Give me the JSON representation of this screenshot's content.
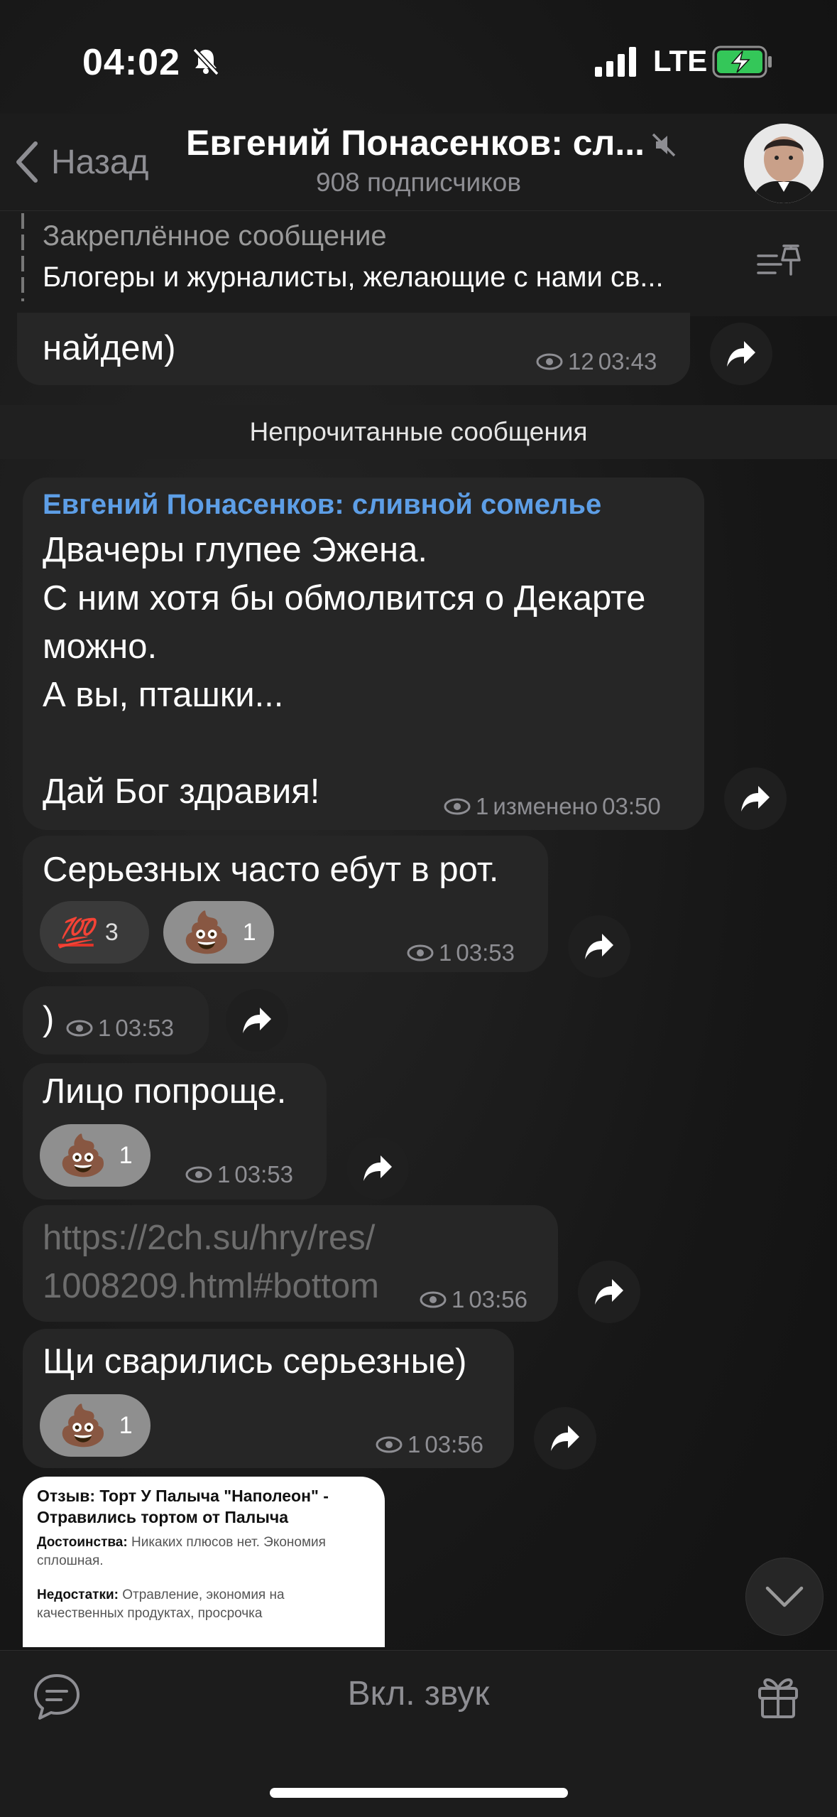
{
  "status": {
    "time": "04:02",
    "network": "LTE"
  },
  "header": {
    "back_label": "Назад",
    "title": "Евгений Понасенков: сл...",
    "subtitle": "908 подписчиков"
  },
  "pinned": {
    "title": "Закреплённое сообщение",
    "text": "Блогеры и журналисты, желающие с нами св..."
  },
  "messages": [
    {
      "text": "найдем)",
      "views": "12",
      "time": "03:43"
    },
    {
      "sender": "Евгений Понасенков: сливной сомелье",
      "text": "Двачеры глупее Эжена.\nС ним хотя бы обмолвится о Декарте\nможно.\nА вы, пташки...\n\nДай Бог здравия!",
      "views": "1",
      "edited": "изменено",
      "time": "03:50"
    },
    {
      "text": "Серьезных часто ебут в рот.",
      "views": "1",
      "time": "03:53",
      "reactions": [
        {
          "emoji": "💯",
          "count": "3"
        },
        {
          "emoji": "💩",
          "count": "1"
        }
      ]
    },
    {
      "text": ")",
      "views": "1",
      "time": "03:53"
    },
    {
      "text": "Лицо попроще.",
      "views": "1",
      "time": "03:53",
      "reactions": [
        {
          "emoji": "💩",
          "count": "1"
        }
      ]
    },
    {
      "text": "https://2ch.su/hry/res/\n1008209.html#bottom",
      "views": "1",
      "time": "03:56"
    },
    {
      "text": "Щи сварились серьезные)",
      "views": "1",
      "time": "03:56",
      "reactions": [
        {
          "emoji": "💩",
          "count": "1"
        }
      ]
    }
  ],
  "unread_label": "Непрочитанные сообщения",
  "preview": {
    "title": "Отзыв: Торт У Палыча \"Наполеон\" - Отравились тортом от Палыча",
    "pros_label": "Достоинства:",
    "pros": "Никаких плюсов нет. Экономия сплошная.",
    "cons_label": "Недостатки:",
    "cons": "Отравление, экономия на качественных продуктах, просрочка"
  },
  "bottom": {
    "unmute_label": "Вкл. звук"
  }
}
